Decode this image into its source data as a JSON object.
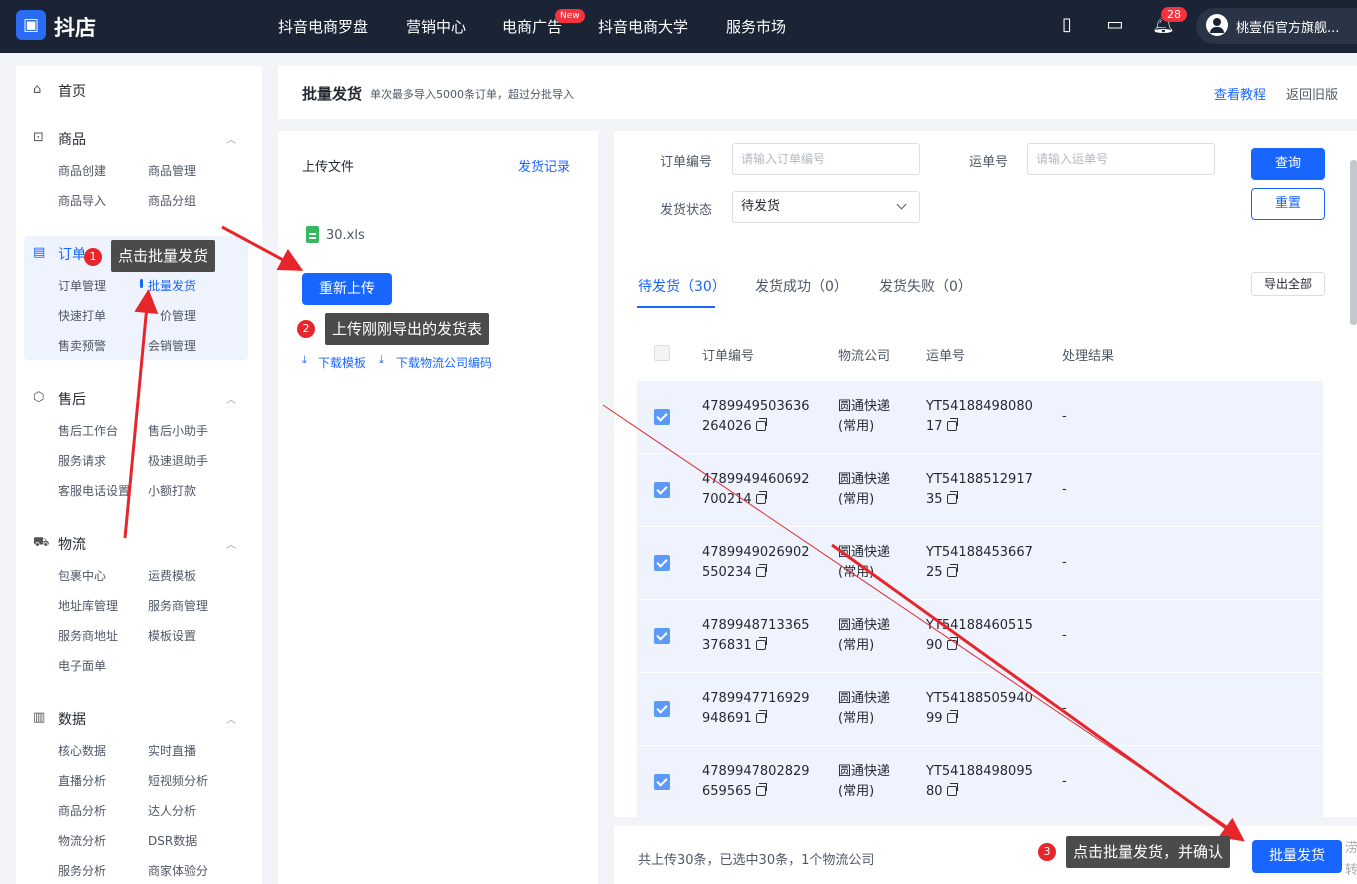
{
  "topbar": {
    "logo_text": "抖店",
    "nav": [
      "抖音电商罗盘",
      "营销中心",
      "电商广告",
      "抖音电商大学",
      "服务市场"
    ],
    "new_badge": "New",
    "bell_count": "28",
    "username": "桃壹佰官方旗舰..."
  },
  "sidebar": {
    "home": "首页",
    "sections": {
      "goods": {
        "title": "商品",
        "items": [
          "商品创建",
          "商品管理",
          "商品导入",
          "商品分组"
        ]
      },
      "orders": {
        "title": "订单",
        "items": [
          "订单管理",
          "批量发货",
          "快速打单",
          "价管理",
          "售卖预警",
          "会销管理"
        ]
      },
      "aftersale": {
        "title": "售后",
        "items": [
          "售后工作台",
          "售后小助手",
          "服务请求",
          "极速退助手",
          "客服电话设置",
          "小额打款"
        ]
      },
      "logistics": {
        "title": "物流",
        "items": [
          "包裹中心",
          "运费模板",
          "地址库管理",
          "服务商管理",
          "服务商地址",
          "模板设置",
          "电子面单"
        ]
      },
      "data": {
        "title": "数据",
        "items": [
          "核心数据",
          "实时直播",
          "直播分析",
          "短视频分析",
          "商品分析",
          "达人分析",
          "物流分析",
          "DSR数据",
          "服务分析",
          "商家体验分"
        ]
      }
    }
  },
  "header": {
    "title": "批量发货",
    "subtitle": "单次最多导入5000条订单，超过分批导入",
    "tutorial_link": "查看教程",
    "back_link": "返回旧版"
  },
  "upload": {
    "title": "上传文件",
    "record_link": "发货记录",
    "file_name": "30.xls",
    "reupload_btn": "重新上传",
    "download_template": "下载模板",
    "download_codes": "下载物流公司编码"
  },
  "filters": {
    "order_label": "订单编号",
    "order_placeholder": "请输入订单编号",
    "waybill_label": "运单号",
    "waybill_placeholder": "请输入运单号",
    "status_label": "发货状态",
    "status_value": "待发货",
    "query_btn": "查询",
    "reset_btn": "重置"
  },
  "tabs": [
    "待发货（30）",
    "发货成功（0）",
    "发货失败（0）"
  ],
  "export_btn": "导出全部",
  "table": {
    "headers": [
      "订单编号",
      "物流公司",
      "运单号",
      "处理结果"
    ],
    "rows": [
      {
        "order1": "4789949503636",
        "order2": "264026",
        "company1": "圆通快递",
        "company2": "(常用)",
        "waybill1": "YT54188498080",
        "waybill2": "17",
        "result": "-"
      },
      {
        "order1": "4789949460692",
        "order2": "700214",
        "company1": "圆通快递",
        "company2": "(常用)",
        "waybill1": "YT54188512917",
        "waybill2": "35",
        "result": "-"
      },
      {
        "order1": "4789949026902",
        "order2": "550234",
        "company1": "圆通快递",
        "company2": "(常用)",
        "waybill1": "YT54188453667",
        "waybill2": "25",
        "result": "-"
      },
      {
        "order1": "4789948713365",
        "order2": "376831",
        "company1": "圆通快递",
        "company2": "(常用)",
        "waybill1": "YT54188460515",
        "waybill2": "90",
        "result": "-"
      },
      {
        "order1": "4789947716929",
        "order2": "948691",
        "company1": "圆通快递",
        "company2": "(常用)",
        "waybill1": "YT54188505940",
        "waybill2": "99",
        "result": "-"
      },
      {
        "order1": "4789947802829",
        "order2": "659565",
        "company1": "圆通快递",
        "company2": "(常用)",
        "waybill1": "YT54188498095",
        "waybill2": "80",
        "result": "-"
      }
    ]
  },
  "footer": {
    "summary": "共上传30条，已选中30条，1个物流公司",
    "batch_btn": "批量发货",
    "edge_text": "涝\n转"
  },
  "annotations": [
    {
      "num": "1",
      "text": "点击批量发货"
    },
    {
      "num": "2",
      "text": "上传刚刚导出的发货表"
    },
    {
      "num": "3",
      "text": "点击批量发货，并确认"
    }
  ],
  "colors": {
    "primary": "#1966ff",
    "topbar": "#1b2434",
    "annotation_red": "#e6262b"
  }
}
